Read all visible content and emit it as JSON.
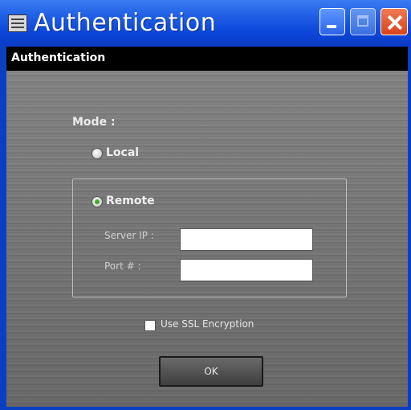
{
  "window": {
    "title": "Authentication",
    "controls": {
      "minimize": "minimize-icon",
      "maximize": "maximize-icon",
      "close": "close-icon"
    }
  },
  "header": {
    "title": "Authentication"
  },
  "form": {
    "mode_label": "Mode :",
    "local_label": "Local",
    "remote_label": "Remote",
    "selected_mode": "Remote",
    "server_ip_label": "Server IP :",
    "server_ip_value": "",
    "port_label": "Port #     :",
    "port_value": "",
    "ssl_label": "Use SSL Encryption",
    "ssl_checked": false,
    "ok_label": "OK"
  },
  "colors": {
    "titlebar": "#0b45d8",
    "header_bar": "#000000",
    "radio_selected": "#3fae2a"
  }
}
